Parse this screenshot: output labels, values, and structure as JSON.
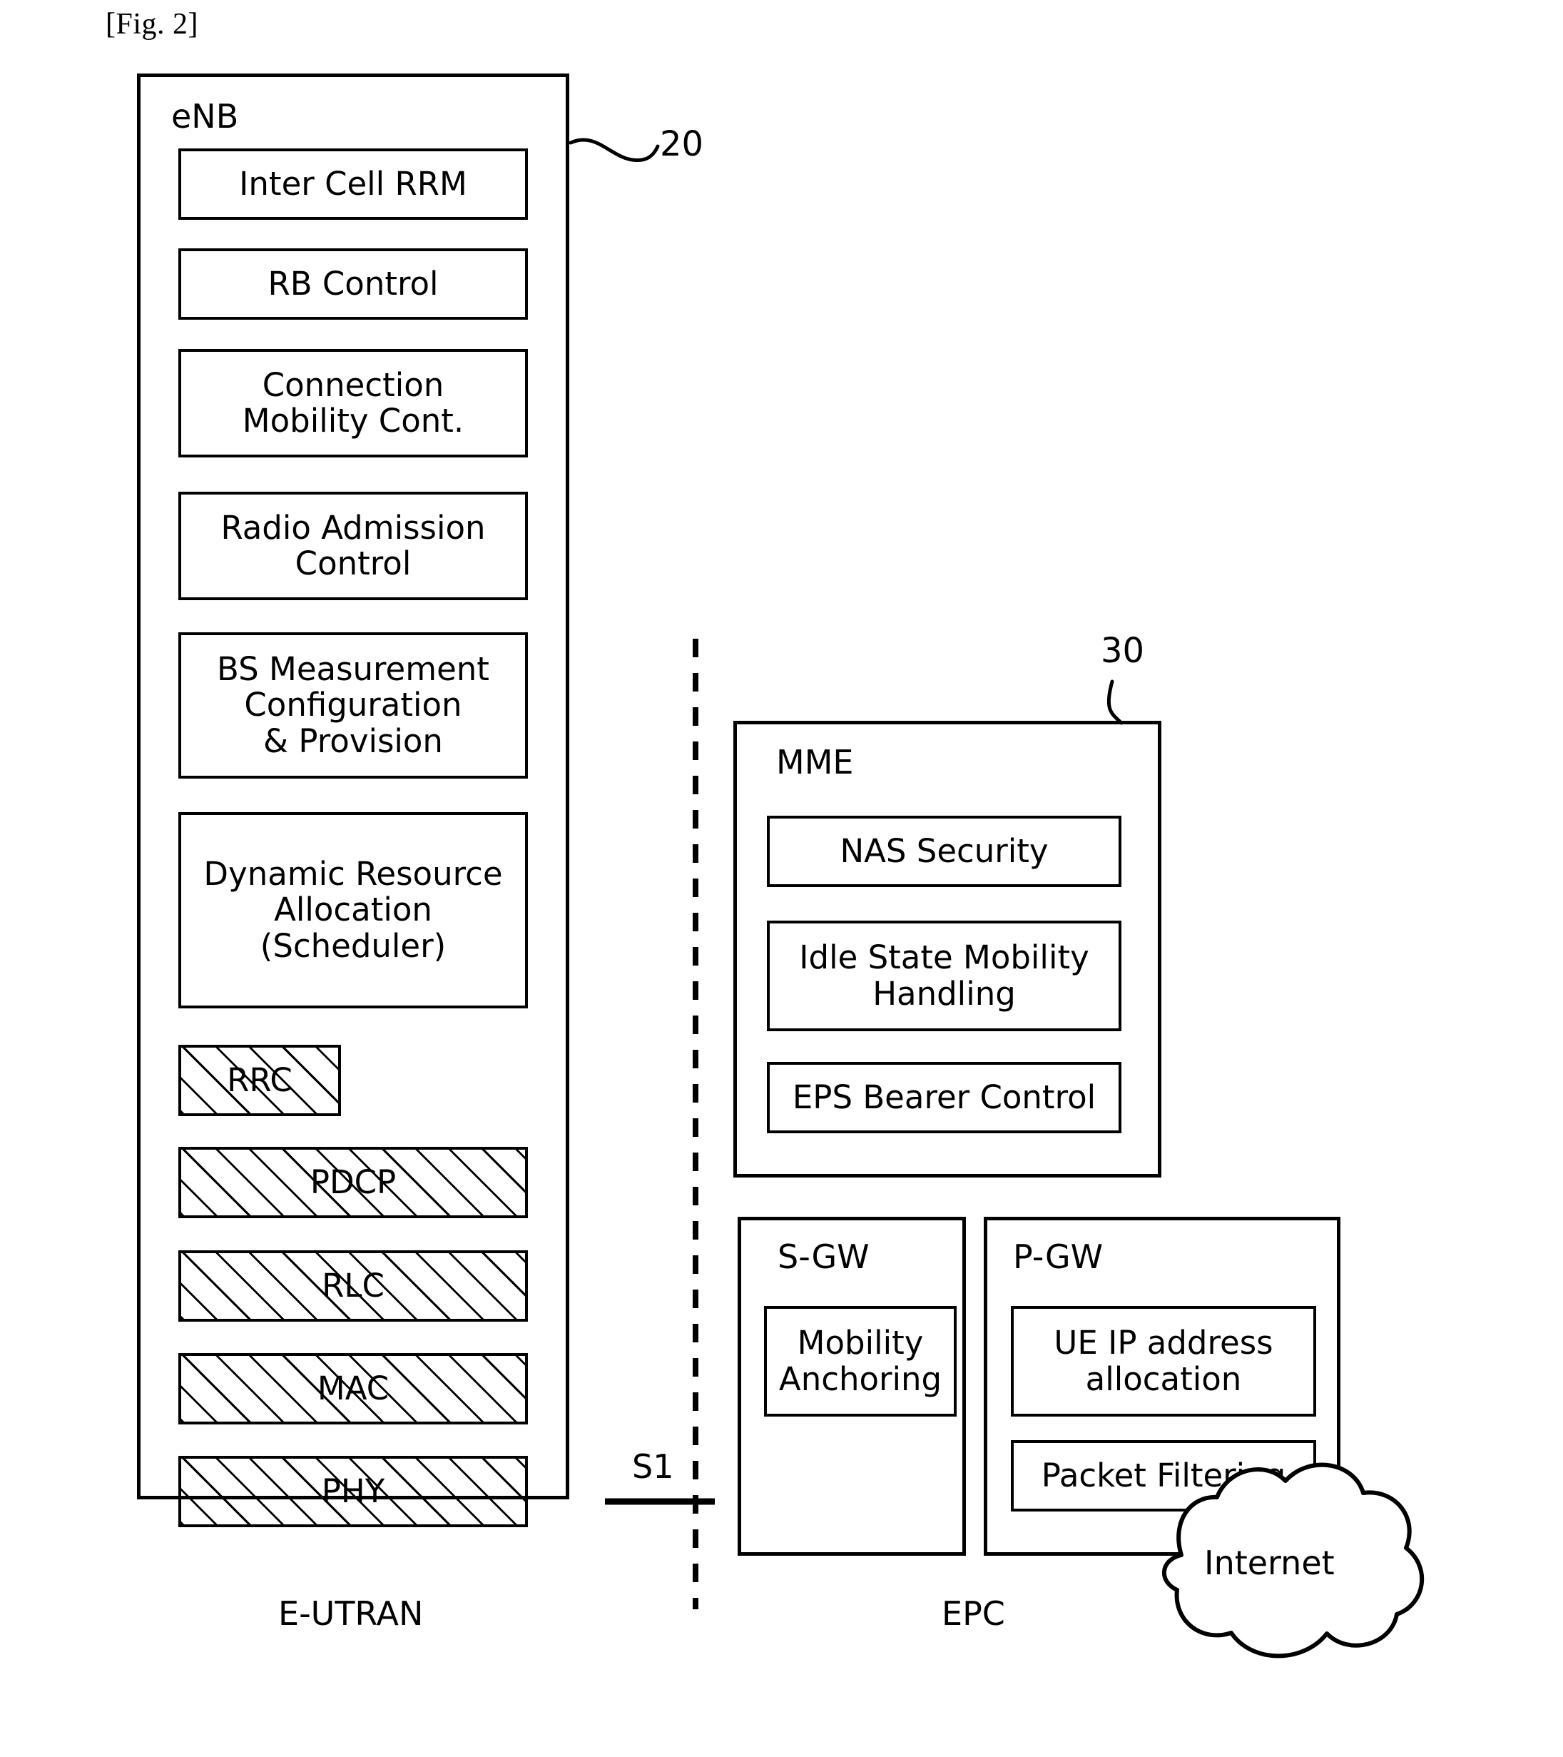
{
  "figure": {
    "label": "[Fig. 2]"
  },
  "reference_numerals": {
    "enb": "20",
    "mme": "30"
  },
  "enb": {
    "title": "eNB",
    "function_blocks": [
      {
        "label": "Inter Cell RRM"
      },
      {
        "label": "RB Control"
      },
      {
        "label": "Connection\nMobility Cont."
      },
      {
        "label": "Radio Admission\nControl"
      },
      {
        "label": "BS Measurement\nConfiguration\n& Provision"
      },
      {
        "label": "Dynamic Resource\nAllocation\n(Scheduler)"
      }
    ],
    "protocol_layers": [
      {
        "label": "RRC"
      },
      {
        "label": "PDCP"
      },
      {
        "label": "RLC"
      },
      {
        "label": "MAC"
      },
      {
        "label": "PHY"
      }
    ]
  },
  "mme": {
    "title": "MME",
    "function_blocks": [
      {
        "label": "NAS Security"
      },
      {
        "label": "Idle State Mobility\nHandling"
      },
      {
        "label": "EPS Bearer Control"
      }
    ]
  },
  "sgw": {
    "title": "S-GW",
    "function_blocks": [
      {
        "label": "Mobility\nAnchoring"
      }
    ]
  },
  "pgw": {
    "title": "P-GW",
    "function_blocks": [
      {
        "label": "UE IP address\nallocation"
      },
      {
        "label": "Packet Filtering"
      }
    ]
  },
  "interfaces": {
    "s1": "S1"
  },
  "domains": {
    "left": "E-UTRAN",
    "right": "EPC"
  },
  "external": {
    "cloud": "Internet"
  },
  "colors": {
    "stroke": "#000000",
    "background": "#ffffff"
  }
}
